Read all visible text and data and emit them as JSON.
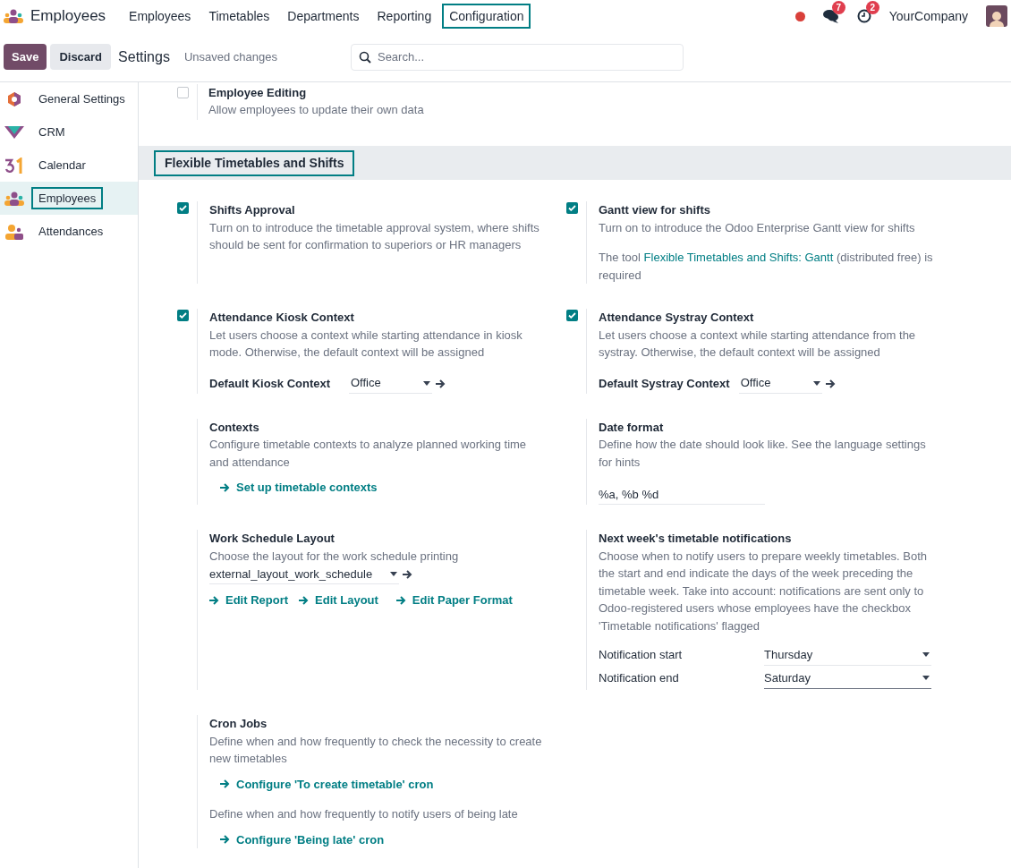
{
  "navbar": {
    "app_name": "Employees",
    "menu": [
      {
        "label": "Employees",
        "selected": false
      },
      {
        "label": "Timetables",
        "selected": false
      },
      {
        "label": "Departments",
        "selected": false
      },
      {
        "label": "Reporting",
        "selected": false
      },
      {
        "label": "Configuration",
        "selected": true
      }
    ],
    "messages_badge": "7",
    "activities_badge": "2",
    "company": "YourCompany"
  },
  "control_panel": {
    "save": "Save",
    "discard": "Discard",
    "title": "Settings",
    "status": "Unsaved changes",
    "search": {
      "placeholder": "Search..."
    }
  },
  "sidebar": {
    "items": [
      {
        "label": "General Settings",
        "selected": false
      },
      {
        "label": "CRM",
        "selected": false
      },
      {
        "label": "Calendar",
        "selected": false
      },
      {
        "label": "Employees",
        "selected": true
      },
      {
        "label": "Attendances",
        "selected": false
      }
    ]
  },
  "top_setting": {
    "title": "Employee Editing",
    "description": "Allow employees to update their own data",
    "checked": false
  },
  "section": {
    "title": "Flexible Timetables and Shifts"
  },
  "settings": [
    {
      "title": "Shifts Approval",
      "checked": true,
      "blocks": [
        {
          "kind": "text",
          "text": "Turn on to introduce the timetable approval system, where shifts should be sent for confirmation to superiors or HR managers"
        }
      ]
    },
    {
      "title": "Gantt view for shifts",
      "checked": true,
      "blocks": [
        {
          "kind": "text",
          "text": "Turn on to introduce the Odoo Enterprise Gantt view for shifts"
        },
        {
          "kind": "note",
          "before": "The tool ",
          "link": "Flexible Timetables and Shifts: Gantt",
          "after": " (distributed free) is required"
        }
      ]
    },
    {
      "title": "Attendance Kiosk Context",
      "checked": true,
      "blocks": [
        {
          "kind": "text",
          "text": "Let users choose a context while starting attendance in kiosk mode. Otherwise, the default context will be assigned"
        },
        {
          "kind": "many2one",
          "label": "Default Kiosk Context",
          "value": "Office"
        }
      ]
    },
    {
      "title": "Attendance Systray Context",
      "checked": true,
      "blocks": [
        {
          "kind": "text",
          "text": "Let users choose a context while starting attendance from the systray. Otherwise, the default context will be assigned"
        },
        {
          "kind": "many2one",
          "label": "Default Systray Context",
          "value": "Office"
        }
      ]
    },
    {
      "title": "Contexts",
      "blocks": [
        {
          "kind": "text",
          "text": "Configure timetable contexts to analyze planned working time and attendance"
        },
        {
          "kind": "links",
          "links": [
            "Set up timetable contexts"
          ]
        }
      ]
    },
    {
      "title": "Date format",
      "blocks": [
        {
          "kind": "text",
          "text": "Define how the date should look like. See the language settings for hints"
        },
        {
          "kind": "input",
          "value": "%a, %b %d"
        }
      ]
    },
    {
      "title": "Work Schedule Layout",
      "blocks": [
        {
          "kind": "text",
          "text": "Choose the layout for the work schedule printing"
        },
        {
          "kind": "select",
          "value": "external_layout_work_schedule"
        },
        {
          "kind": "links",
          "links": [
            "Edit Report",
            "Edit Layout",
            "Edit Paper Format"
          ]
        }
      ]
    },
    {
      "title": "Next week's timetable notifications",
      "blocks": [
        {
          "kind": "text",
          "text": "Choose when to notify users to prepare weekly timetables. Both the start and end indicate the days of the week preceding the timetable week. Take into account: notifications are sent only to Odoo-registered users whose employees have the checkbox 'Timetable notifications' flagged"
        },
        {
          "kind": "rows",
          "rows": [
            {
              "label": "Notification start",
              "value": "Thursday"
            },
            {
              "label": "Notification end",
              "value": "Saturday"
            }
          ]
        }
      ]
    },
    {
      "title": "Cron Jobs",
      "blocks": [
        {
          "kind": "text",
          "text": "Define when and how frequently to check the necessity to create new timetables"
        },
        {
          "kind": "links",
          "links": [
            "Configure 'To create timetable' cron"
          ]
        },
        {
          "kind": "text",
          "text": "Define when and how frequently to notify users of being late"
        },
        {
          "kind": "links",
          "links": [
            "Configure 'Being late' cron"
          ]
        }
      ]
    }
  ]
}
